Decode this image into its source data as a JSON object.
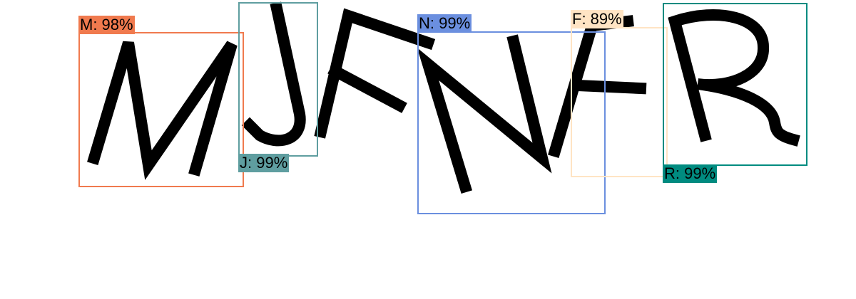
{
  "captcha": {
    "characters": [
      "M",
      "J",
      "F",
      "N",
      "F",
      "R"
    ],
    "glyph_color": "#000000"
  },
  "detections": [
    {
      "label": "M: 98%",
      "char": "M",
      "confidence": 98,
      "color": "#f07a4e"
    },
    {
      "label": "J: 99%",
      "char": "J",
      "confidence": 99,
      "color": "#5f9ea0"
    },
    {
      "label": "N: 99%",
      "char": "N",
      "confidence": 99,
      "color": "#6b8fdf"
    },
    {
      "label": "F: 89%",
      "char": "F",
      "confidence": 89,
      "color": "#ffe4c4"
    },
    {
      "label": "R: 99%",
      "char": "R",
      "confidence": 99,
      "color": "#008b80"
    }
  ]
}
